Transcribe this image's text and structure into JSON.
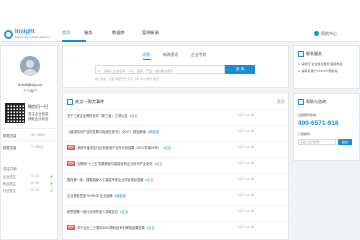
{
  "brand": {
    "name": "Insight",
    "tagline": "Enterprise insight platform"
  },
  "nav": {
    "items": [
      "首页",
      "服务",
      "数据库",
      "案例新闻"
    ],
    "active_index": 0
  },
  "help": {
    "label": "帮助中心"
  },
  "profile": {
    "username": "Sutuf@sby.cn",
    "badge": "个人用户",
    "wechat_title": "微信扫一扫",
    "wechat_line1": "关注企业信息",
    "wechat_line2": "获取企业动态"
  },
  "stats": [
    {
      "label": "数据流量",
      "value": "41 / 5000"
    },
    {
      "label": "数据流量",
      "value": "3 / 5000"
    }
  ],
  "subscriptions": {
    "title": "关注订阅",
    "items": [
      {
        "label": "企业关注",
        "value": "0 / 10"
      },
      {
        "label": "热点关注",
        "value": "0 / 10"
      },
      {
        "label": "行业关注",
        "value": "0 / 10"
      }
    ]
  },
  "search": {
    "tabs": [
      "机构",
      "新闻资讯",
      "企业专利"
    ],
    "active_tab": 0,
    "placeholder": "请输入企业名称、人名、品牌、产品、地址等关键字",
    "button": "查 询",
    "hot_words": "热门搜索：百度 阿里巴巴 京东 小米 华为 腾讯 美团"
  },
  "events": {
    "title": "热点一周大事件",
    "more": "更多",
    "items": [
      {
        "tag": "",
        "title": "关于三家企业跨境合作「新三板」立项公告",
        "keyword": "#企业",
        "date": "2017-12-30"
      },
      {
        "tag": "",
        "title": "《健康知识产业的发展与挑战白皮书》（2017）报告解读",
        "keyword": "#新能源",
        "date": "2017-12-30"
      },
      {
        "tag": "推荐",
        "title": "深圳市宝安区社区科技资产合作计划结果（2017年第29号）",
        "keyword": "#企业",
        "date": "2017-12-30"
      },
      {
        "tag": "推荐",
        "title": "互联网“十三五”发展规划与智能化的企业时代产业深化",
        "keyword": "#企业",
        "date": "2017-12-30"
      },
      {
        "tag": "",
        "title": "国内第一家，搜集超级人工智能专家企业项目成绩显著",
        "keyword": "#企业",
        "date": "2017-12-30"
      },
      {
        "tag": "",
        "title": "企业首批签发“SH9045”企业品牌",
        "keyword": "#新能源",
        "date": "2017-12-30"
      },
      {
        "tag": "",
        "title": "新思想第一批行业研究进入领域定位",
        "keyword": "#企业",
        "date": "2017-12-30"
      },
      {
        "tag": "推荐",
        "title": "关于企业二十周年4000项科技专利审核结果进展",
        "keyword": "#企业",
        "date": "2017-12-30"
      }
    ]
  },
  "contact": {
    "title": "联系服务",
    "line1": "1. 请拨打“企业信息服务”客服电话",
    "line2": "2. 请联系我们“CNCTP”服务站"
  },
  "support": {
    "title": "帮助与咨询",
    "hotline_label": "全国服务热线：",
    "phone": "400-6571-918",
    "email_label": "订阅邮件：",
    "email_placeholder": "请输入您的邮箱",
    "email_button": "提交"
  }
}
